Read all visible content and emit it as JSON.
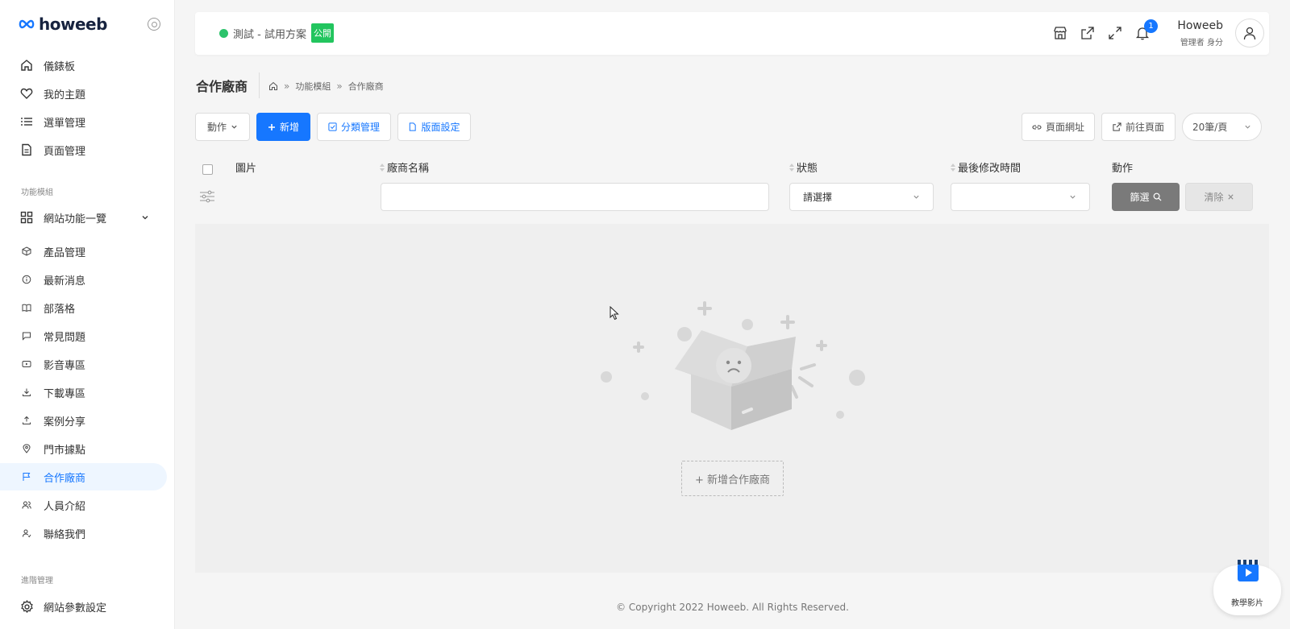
{
  "brand": {
    "name": "howeeb",
    "accent": "#1677ff",
    "ok": "#22c55e"
  },
  "sidebar": {
    "items": [
      {
        "label": "儀錶板",
        "icon": "home-icon"
      },
      {
        "label": "我的主題",
        "icon": "heart-icon"
      },
      {
        "label": "選單管理",
        "icon": "list-icon"
      },
      {
        "label": "頁面管理",
        "icon": "document-icon"
      }
    ],
    "section_modules": "功能模組",
    "site_features": {
      "label": "網站功能一覽",
      "icon": "grid-icon"
    },
    "modules": [
      {
        "label": "產品管理",
        "icon": "cube-icon"
      },
      {
        "label": "最新消息",
        "icon": "info-icon"
      },
      {
        "label": "部落格",
        "icon": "book-icon"
      },
      {
        "label": "常見問題",
        "icon": "chat-icon"
      },
      {
        "label": "影音專區",
        "icon": "video-icon"
      },
      {
        "label": "下載專區",
        "icon": "download-icon"
      },
      {
        "label": "案例分享",
        "icon": "upload-icon"
      },
      {
        "label": "門市據點",
        "icon": "location-icon"
      },
      {
        "label": "合作廠商",
        "icon": "flag-icon",
        "active": true
      },
      {
        "label": "人員介紹",
        "icon": "users-icon"
      },
      {
        "label": "聯絡我們",
        "icon": "contact-icon"
      }
    ],
    "section_advanced": "進階管理",
    "settings": {
      "label": "網站參數設定",
      "icon": "gear-icon"
    }
  },
  "header": {
    "site_name": "測試 - 試用方案",
    "public_badge": "公開",
    "notification_count": "1",
    "user_name": "Howeeb",
    "user_role": "管理者 身分"
  },
  "page": {
    "title": "合作廠商",
    "breadcrumb": [
      "功能模組",
      "合作廠商"
    ]
  },
  "toolbar": {
    "action": "動作",
    "add": "新增",
    "category": "分類管理",
    "layout": "版面設定",
    "page_url": "頁面網址",
    "goto_page": "前往頁面",
    "per_page": "20筆/頁"
  },
  "table": {
    "headers": {
      "image": "圖片",
      "vendor_name": "廠商名稱",
      "status": "狀態",
      "modified": "最後修改時間",
      "actions": "動作"
    },
    "filters": {
      "status_placeholder": "請選擇",
      "filter_button": "篩選",
      "clear_button": "清除"
    }
  },
  "empty": {
    "add_button": "+ 新增合作廠商"
  },
  "footer": {
    "copyright": "© Copyright 2022 Howeeb. All Rights Reserved."
  },
  "tutorial": {
    "label": "教學影片"
  }
}
